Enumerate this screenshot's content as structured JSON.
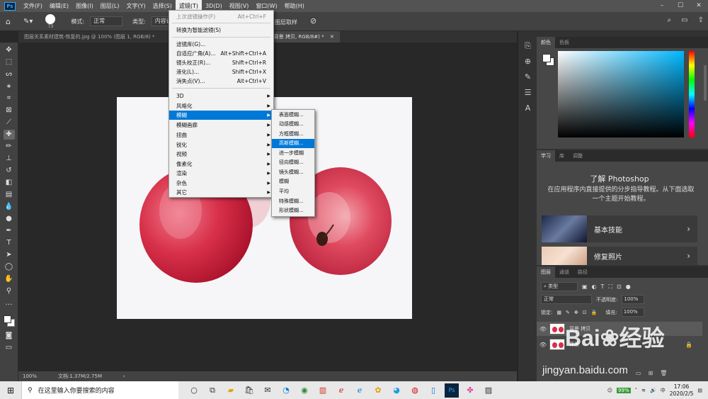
{
  "menubar": {
    "logo": "Ps",
    "items": [
      "文件(F)",
      "编辑(E)",
      "图像(I)",
      "图层(L)",
      "文字(Y)",
      "选择(S)",
      "滤镜(T)",
      "3D(D)",
      "视图(V)",
      "窗口(W)",
      "帮助(H)"
    ],
    "active_index": 6,
    "window_controls": [
      "–",
      "☐",
      "✕"
    ]
  },
  "options_bar": {
    "brush_size": "73",
    "mode_label": "模式:",
    "mode_value": "正常",
    "type_label": "类型:",
    "type_value": "内容识别",
    "layers_label": "图层取样"
  },
  "tabs": [
    {
      "label": "图层关系素材建筑-恢复的.jpg @ 100% (图层 1, RGB/8) *"
    },
    {
      "label": "(背景 拷贝, RGB/8#) *"
    }
  ],
  "status_bar": {
    "zoom": "100%",
    "doc": "文档:1.37M/2.75M"
  },
  "filter_menu": {
    "items": [
      {
        "label": "上次滤镜操作(F)",
        "shortcut": "Alt+Ctrl+F",
        "disabled": true
      },
      {
        "sep": true
      },
      {
        "label": "转换为智能滤镜(S)"
      },
      {
        "sep": true
      },
      {
        "label": "滤镜库(G)..."
      },
      {
        "label": "自适应广角(A)...",
        "shortcut": "Alt+Shift+Ctrl+A"
      },
      {
        "label": "镜头校正(R)...",
        "shortcut": "Shift+Ctrl+R"
      },
      {
        "label": "液化(L)...",
        "shortcut": "Shift+Ctrl+X"
      },
      {
        "label": "消失点(V)...",
        "shortcut": "Alt+Ctrl+V"
      },
      {
        "sep": true
      },
      {
        "label": "3D",
        "sub": true
      },
      {
        "label": "风格化",
        "sub": true
      },
      {
        "label": "模糊",
        "sub": true,
        "highlight": true
      },
      {
        "label": "模糊画廊",
        "sub": true
      },
      {
        "label": "扭曲",
        "sub": true
      },
      {
        "label": "锐化",
        "sub": true
      },
      {
        "label": "视频",
        "sub": true
      },
      {
        "label": "像素化",
        "sub": true
      },
      {
        "label": "渲染",
        "sub": true
      },
      {
        "label": "杂色",
        "sub": true
      },
      {
        "label": "其它",
        "sub": true
      }
    ]
  },
  "blur_submenu": {
    "items": [
      "表面模糊...",
      "动感模糊...",
      "方框模糊...",
      "高斯模糊...",
      "进一步模糊",
      "径向模糊...",
      "镜头模糊...",
      "模糊",
      "平均",
      "特殊模糊...",
      "形状模糊..."
    ],
    "highlight_index": 3
  },
  "color_panel": {
    "tabs": [
      "颜色",
      "色板"
    ]
  },
  "learn_panel": {
    "tabs": [
      "学习",
      "库",
      "调整"
    ],
    "title": "了解 Photoshop",
    "description": "在应用程序内直接提供的分步指导教程。从下面选取一个主题开始教程。",
    "cards": [
      "基本技能",
      "修复照片"
    ]
  },
  "layers_panel": {
    "tabs": [
      "图层",
      "通道",
      "路径"
    ],
    "kind_label": "类型",
    "blend_mode": "正常",
    "opacity_label": "不透明度:",
    "opacity_value": "100%",
    "lock_label": "锁定:",
    "fill_label": "填充:",
    "fill_value": "100%",
    "layers": [
      {
        "name": "背景 拷贝"
      },
      {
        "name": "背景"
      }
    ]
  },
  "taskbar": {
    "search_placeholder": "在这里输入你要搜索的内容",
    "battery": "99%",
    "ime": "中",
    "time": "17:06",
    "date": "2020/2/5"
  },
  "watermark": {
    "brand": "Bai",
    "brand2": "经验",
    "url": "jingyan.baidu.com"
  },
  "colors": {
    "accent": "#0078d7",
    "ps_blue": "#31a8ff",
    "apple_red": "#d8304a"
  }
}
